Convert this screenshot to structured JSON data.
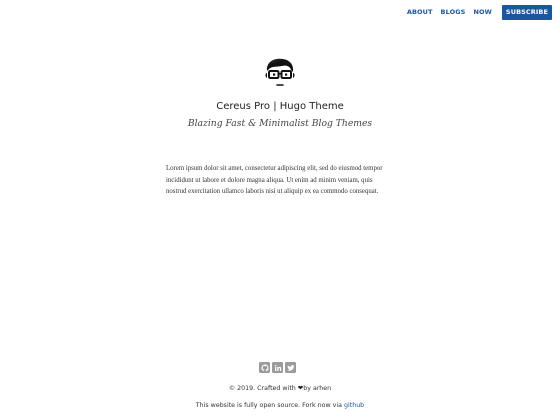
{
  "nav": {
    "items": [
      "ABOUT",
      "BLOGS",
      "NOW"
    ],
    "subscribe_label": "SUBSCRIBE"
  },
  "header": {
    "title": "Cereus Pro | Hugo Theme",
    "tagline": "Blazing Fast & Minimalist Blog Themes"
  },
  "main": {
    "intro": "Lorem ipsum dolor sit amet, consectetur adipiscing elit, sed do eiusmod tempor incididunt ut labore et dolore magna aliqua. Ut enim ad minim veniam, quis nostrud exercitation ullamco laboris nisi ut aliquip ex ea commodo consequat."
  },
  "footer": {
    "social_icons": [
      "github-icon",
      "linkedin-icon",
      "twitter-icon"
    ],
    "copyright_prefix": "© 2019. Crafted with ",
    "copyright_suffix": "by arhen",
    "open_source_text": "This website is fully open source. Fork now via ",
    "github_link": "github"
  },
  "colors": {
    "accent": "#1a57a3",
    "icon_gray": "#9b9b9b"
  }
}
